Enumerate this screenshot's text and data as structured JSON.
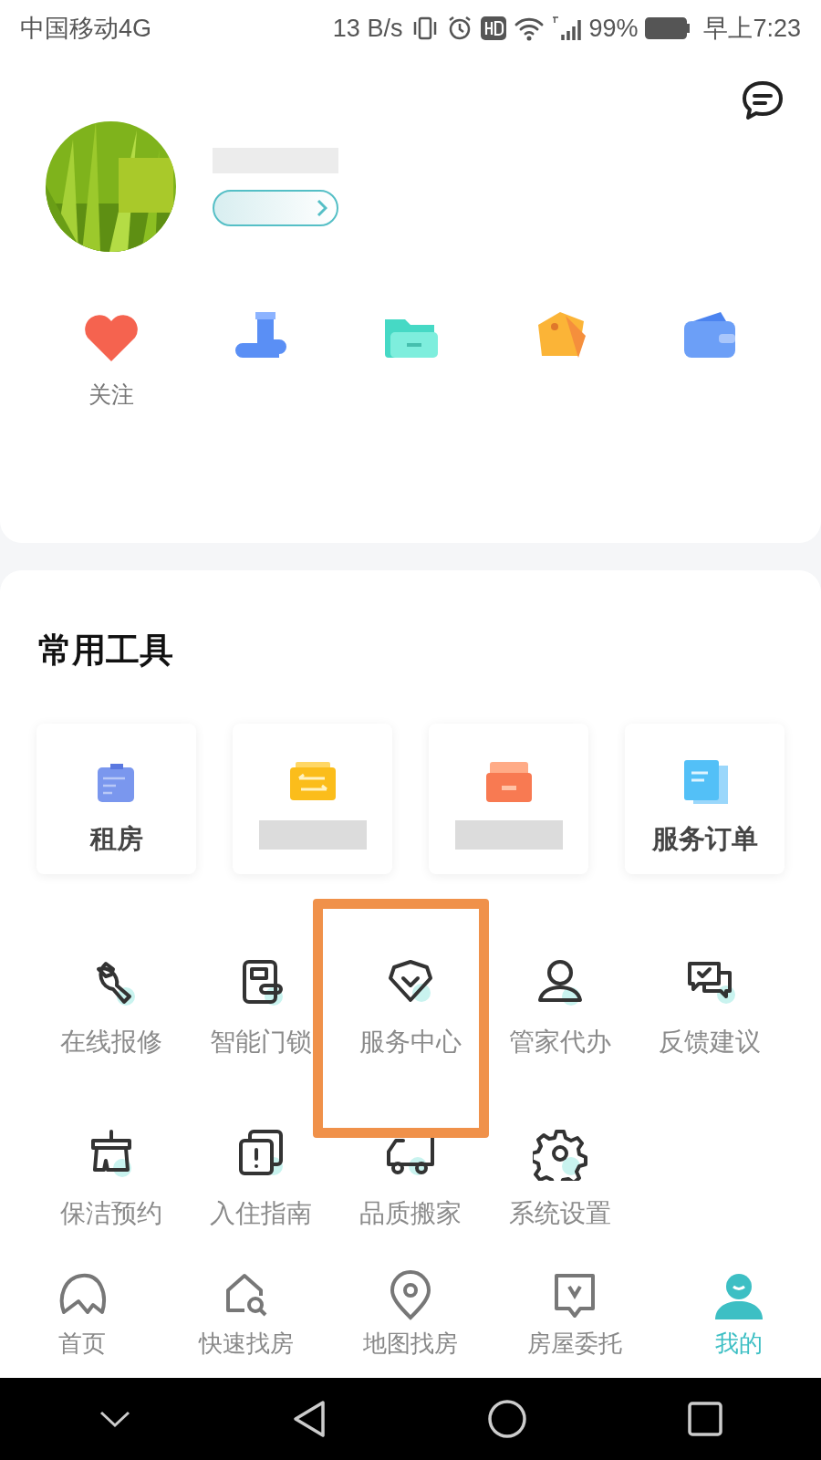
{
  "status_bar": {
    "carrier": "中国移动4G",
    "speed": "13 B/s",
    "battery": "99%",
    "time": "早上7:23"
  },
  "profile": {
    "quick_links": [
      {
        "kind": "heart",
        "label": "关注"
      },
      {
        "kind": "boot"
      },
      {
        "kind": "folder"
      },
      {
        "kind": "tag"
      },
      {
        "kind": "wallet"
      }
    ]
  },
  "tools": {
    "title": "常用工具",
    "tiles": [
      {
        "kind": "clipboard",
        "label": "租房"
      },
      {
        "kind": "transfer"
      },
      {
        "kind": "inbox"
      },
      {
        "kind": "document",
        "label": "服务订单"
      }
    ],
    "grid": [
      {
        "kind": "wrench",
        "label": "在线报修"
      },
      {
        "kind": "lock",
        "label": "智能门锁"
      },
      {
        "kind": "shield",
        "label": "服务中心"
      },
      {
        "kind": "person",
        "label": "管家代办"
      },
      {
        "kind": "chat",
        "label": "反馈建议"
      },
      {
        "kind": "broom",
        "label": "保洁预约"
      },
      {
        "kind": "notice",
        "label": "入住指南"
      },
      {
        "kind": "truck",
        "label": "品质搬家"
      },
      {
        "kind": "gear",
        "label": "系统设置"
      }
    ]
  },
  "tab_bar": [
    {
      "kind": "home",
      "label": "首页",
      "selected": false
    },
    {
      "kind": "search",
      "label": "快速找房",
      "selected": false
    },
    {
      "kind": "pin",
      "label": "地图找房",
      "selected": false
    },
    {
      "kind": "bubble",
      "label": "房屋委托",
      "selected": false
    },
    {
      "kind": "me",
      "label": "我的",
      "selected": true
    }
  ]
}
